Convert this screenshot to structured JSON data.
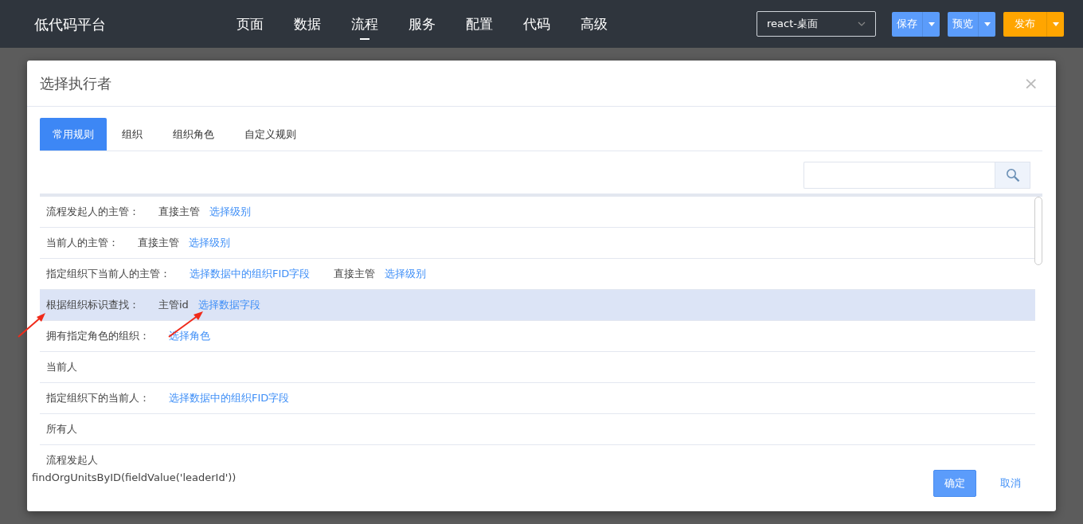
{
  "app": {
    "title": "低代码平台",
    "nav": [
      {
        "label": "页面",
        "selected": false
      },
      {
        "label": "数据",
        "selected": false
      },
      {
        "label": "流程",
        "selected": true
      },
      {
        "label": "服务",
        "selected": false
      },
      {
        "label": "配置",
        "selected": false
      },
      {
        "label": "代码",
        "selected": false
      },
      {
        "label": "高级",
        "selected": false
      }
    ],
    "platform_select": {
      "value": "react-桌面"
    },
    "buttons": [
      {
        "label": "保存",
        "kind": "primary"
      },
      {
        "label": "预览",
        "kind": "primary"
      },
      {
        "label": "发布",
        "kind": "warning"
      }
    ]
  },
  "dialog": {
    "title": "选择执行者",
    "close": "×",
    "tabs": [
      {
        "label": "常用规则",
        "selected": true
      },
      {
        "label": "组织",
        "selected": false
      },
      {
        "label": "组织角色",
        "selected": false
      },
      {
        "label": "自定义规则",
        "selected": false
      }
    ],
    "rules": [
      {
        "selected": false,
        "parts": [
          {
            "kind": "label",
            "text": "流程发起人的主管："
          },
          {
            "kind": "text",
            "text": "直接主管"
          },
          {
            "kind": "link",
            "text": "选择级别"
          }
        ]
      },
      {
        "selected": false,
        "parts": [
          {
            "kind": "label",
            "text": "当前人的主管："
          },
          {
            "kind": "text",
            "text": "直接主管"
          },
          {
            "kind": "link",
            "text": "选择级别"
          }
        ]
      },
      {
        "selected": false,
        "parts": [
          {
            "kind": "label",
            "text": "指定组织下当前人的主管："
          },
          {
            "kind": "link",
            "text": "选择数据中的组织FID字段"
          },
          {
            "kind": "text",
            "text": "直接主管"
          },
          {
            "kind": "link",
            "text": "选择级别"
          }
        ]
      },
      {
        "selected": true,
        "parts": [
          {
            "kind": "label",
            "text": "根据组织标识查找："
          },
          {
            "kind": "text",
            "text": "主管id"
          },
          {
            "kind": "link",
            "text": "选择数据字段"
          }
        ]
      },
      {
        "selected": false,
        "parts": [
          {
            "kind": "label",
            "text": "拥有指定角色的组织："
          },
          {
            "kind": "link",
            "text": "选择角色"
          }
        ]
      },
      {
        "selected": false,
        "parts": [
          {
            "kind": "label",
            "text": "当前人"
          }
        ]
      },
      {
        "selected": false,
        "parts": [
          {
            "kind": "label",
            "text": "指定组织下的当前人："
          },
          {
            "kind": "link",
            "text": "选择数据中的组织FID字段"
          }
        ]
      },
      {
        "selected": false,
        "parts": [
          {
            "kind": "label",
            "text": "所有人"
          }
        ]
      },
      {
        "selected": false,
        "parts": [
          {
            "kind": "label",
            "text": "流程发起人"
          }
        ]
      }
    ],
    "expression": "findOrgUnitsByID(fieldValue('leaderId'))",
    "ok": "确定",
    "cancel": "取消"
  }
}
